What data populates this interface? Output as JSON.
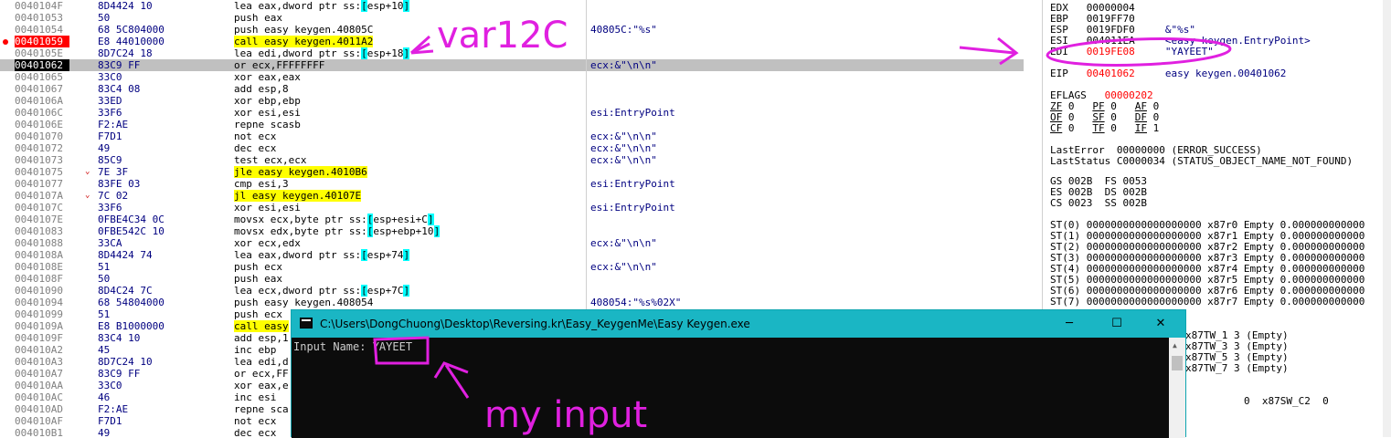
{
  "disassembly": [
    {
      "addr": "0040104F",
      "bytes": "8D4424 10",
      "instr": [
        {
          "t": "lea eax,dword ptr ss:"
        },
        {
          "t": "[",
          "h": "cyan"
        },
        {
          "t": "esp+10"
        },
        {
          "t": "]",
          "h": "cyan"
        }
      ],
      "comment": ""
    },
    {
      "addr": "00401053",
      "bytes": "50",
      "instr": [
        {
          "t": "push eax"
        }
      ],
      "comment": ""
    },
    {
      "addr": "00401054",
      "bytes": "68 5C804000",
      "instr": [
        {
          "t": "push easy keygen.40805C"
        }
      ],
      "comment": "40805C:\"%s\""
    },
    {
      "addr": "00401059",
      "bytes": "E8 44010000",
      "instr": [
        {
          "t": "call easy keygen.4011A2",
          "h": "yellow"
        }
      ],
      "comment": "",
      "bp": true
    },
    {
      "addr": "0040105E",
      "bytes": "8D7C24 18",
      "instr": [
        {
          "t": "lea edi,dword ptr ss:"
        },
        {
          "t": "[",
          "h": "cyan"
        },
        {
          "t": "esp+18"
        },
        {
          "t": "]",
          "h": "cyan"
        }
      ],
      "comment": ""
    },
    {
      "addr": "00401062",
      "bytes": "83C9 FF",
      "instr": [
        {
          "t": "or ecx,FFFFFFFF"
        }
      ],
      "comment": "ecx:&\"\\n\\n\"",
      "current": true
    },
    {
      "addr": "00401065",
      "bytes": "33C0",
      "instr": [
        {
          "t": "xor eax,eax"
        }
      ],
      "comment": ""
    },
    {
      "addr": "00401067",
      "bytes": "83C4 08",
      "instr": [
        {
          "t": "add esp,8"
        }
      ],
      "comment": ""
    },
    {
      "addr": "0040106A",
      "bytes": "33ED",
      "instr": [
        {
          "t": "xor ebp,ebp"
        }
      ],
      "comment": ""
    },
    {
      "addr": "0040106C",
      "bytes": "33F6",
      "instr": [
        {
          "t": "xor esi,esi"
        }
      ],
      "comment": "esi:EntryPoint"
    },
    {
      "addr": "0040106E",
      "bytes": "F2:AE",
      "instr": [
        {
          "t": "repne scasb"
        }
      ],
      "comment": ""
    },
    {
      "addr": "00401070",
      "bytes": "F7D1",
      "instr": [
        {
          "t": "not ecx"
        }
      ],
      "comment": "ecx:&\"\\n\\n\""
    },
    {
      "addr": "00401072",
      "bytes": "49",
      "instr": [
        {
          "t": "dec ecx"
        }
      ],
      "comment": "ecx:&\"\\n\\n\""
    },
    {
      "addr": "00401073",
      "bytes": "85C9",
      "instr": [
        {
          "t": "test ecx,ecx"
        }
      ],
      "comment": "ecx:&\"\\n\\n\""
    },
    {
      "addr": "00401075",
      "bytes": "7E 3F",
      "instr": [
        {
          "t": "jle easy keygen.4010B6",
          "h": "yellow"
        }
      ],
      "comment": "",
      "jump": true
    },
    {
      "addr": "00401077",
      "bytes": "83FE 03",
      "instr": [
        {
          "t": "cmp esi,3"
        }
      ],
      "comment": "esi:EntryPoint"
    },
    {
      "addr": "0040107A",
      "bytes": "7C 02",
      "instr": [
        {
          "t": "jl easy keygen.40107E",
          "h": "yellow"
        }
      ],
      "comment": "",
      "jump": true
    },
    {
      "addr": "0040107C",
      "bytes": "33F6",
      "instr": [
        {
          "t": "xor esi,esi"
        }
      ],
      "comment": "esi:EntryPoint"
    },
    {
      "addr": "0040107E",
      "bytes": "0FBE4C34 0C",
      "instr": [
        {
          "t": "movsx ecx,byte ptr ss:"
        },
        {
          "t": "[",
          "h": "cyan"
        },
        {
          "t": "esp+esi+C"
        },
        {
          "t": "]",
          "h": "cyan"
        }
      ],
      "comment": ""
    },
    {
      "addr": "00401083",
      "bytes": "0FBE542C 10",
      "instr": [
        {
          "t": "movsx edx,byte ptr ss:"
        },
        {
          "t": "[",
          "h": "cyan"
        },
        {
          "t": "esp+ebp+10"
        },
        {
          "t": "]",
          "h": "cyan"
        }
      ],
      "comment": ""
    },
    {
      "addr": "00401088",
      "bytes": "33CA",
      "instr": [
        {
          "t": "xor ecx,edx"
        }
      ],
      "comment": "ecx:&\"\\n\\n\""
    },
    {
      "addr": "0040108A",
      "bytes": "8D4424 74",
      "instr": [
        {
          "t": "lea eax,dword ptr ss:"
        },
        {
          "t": "[",
          "h": "cyan"
        },
        {
          "t": "esp+74"
        },
        {
          "t": "]",
          "h": "cyan"
        }
      ],
      "comment": ""
    },
    {
      "addr": "0040108E",
      "bytes": "51",
      "instr": [
        {
          "t": "push ecx"
        }
      ],
      "comment": "ecx:&\"\\n\\n\""
    },
    {
      "addr": "0040108F",
      "bytes": "50",
      "instr": [
        {
          "t": "push eax"
        }
      ],
      "comment": ""
    },
    {
      "addr": "00401090",
      "bytes": "8D4C24 7C",
      "instr": [
        {
          "t": "lea ecx,dword ptr ss:"
        },
        {
          "t": "[",
          "h": "cyan"
        },
        {
          "t": "esp+7C"
        },
        {
          "t": "]",
          "h": "cyan"
        }
      ],
      "comment": ""
    },
    {
      "addr": "00401094",
      "bytes": "68 54804000",
      "instr": [
        {
          "t": "push easy keygen.408054"
        }
      ],
      "comment": "408054:\"%s%02X\""
    },
    {
      "addr": "00401099",
      "bytes": "51",
      "instr": [
        {
          "t": "push ecx"
        }
      ],
      "comment": ""
    },
    {
      "addr": "0040109A",
      "bytes": "E8 B1000000",
      "instr": [
        {
          "t": "call easy",
          "h": "yellow"
        }
      ],
      "comment": ""
    },
    {
      "addr": "0040109F",
      "bytes": "83C4 10",
      "instr": [
        {
          "t": "add esp,1"
        }
      ],
      "comment": ""
    },
    {
      "addr": "004010A2",
      "bytes": "45",
      "instr": [
        {
          "t": "inc ebp"
        }
      ],
      "comment": ""
    },
    {
      "addr": "004010A3",
      "bytes": "8D7C24 10",
      "instr": [
        {
          "t": "lea edi,d"
        }
      ],
      "comment": ""
    },
    {
      "addr": "004010A7",
      "bytes": "83C9 FF",
      "instr": [
        {
          "t": "or ecx,FF"
        }
      ],
      "comment": ""
    },
    {
      "addr": "004010AA",
      "bytes": "33C0",
      "instr": [
        {
          "t": "xor eax,e"
        }
      ],
      "comment": ""
    },
    {
      "addr": "004010AC",
      "bytes": "46",
      "instr": [
        {
          "t": "inc esi"
        }
      ],
      "comment": ""
    },
    {
      "addr": "004010AD",
      "bytes": "F2:AE",
      "instr": [
        {
          "t": "repne sca"
        }
      ],
      "comment": ""
    },
    {
      "addr": "004010AF",
      "bytes": "F7D1",
      "instr": [
        {
          "t": "not ecx"
        }
      ],
      "comment": ""
    },
    {
      "addr": "004010B1",
      "bytes": "49",
      "instr": [
        {
          "t": "dec ecx"
        }
      ],
      "comment": ""
    }
  ],
  "registers": {
    "edx": {
      "name": "EDX",
      "value": "00000004",
      "info": ""
    },
    "ebp": {
      "name": "EBP",
      "value": "0019FF70",
      "info": ""
    },
    "esp": {
      "name": "ESP",
      "value": "0019FDF0",
      "info": "&\"%s\""
    },
    "esi": {
      "name": "ESI",
      "value": "004011EA",
      "info": "<easy keygen.EntryPoint>"
    },
    "edi": {
      "name": "EDI",
      "value": "0019FE08",
      "info": "\"YAYEET\""
    },
    "eip": {
      "name": "EIP",
      "value": "00401062",
      "info": "easy keygen.00401062"
    },
    "eflags": {
      "name": "EFLAGS",
      "value": "00000202"
    },
    "flags_rows": [
      [
        {
          "n": "ZF",
          "v": "0"
        },
        {
          "n": "PF",
          "v": "0"
        },
        {
          "n": "AF",
          "v": "0"
        }
      ],
      [
        {
          "n": "OF",
          "v": "0"
        },
        {
          "n": "SF",
          "v": "0"
        },
        {
          "n": "DF",
          "v": "0"
        }
      ],
      [
        {
          "n": "CF",
          "v": "0"
        },
        {
          "n": "TF",
          "v": "0"
        },
        {
          "n": "IF",
          "v": "1"
        }
      ]
    ],
    "last_error": "LastError  00000000 (ERROR_SUCCESS)",
    "last_status": "LastStatus C0000034 (STATUS_OBJECT_NAME_NOT_FOUND)",
    "segments": [
      "GS 002B  FS 0053",
      "ES 002B  DS 002B",
      "CS 0023  SS 002B"
    ],
    "fpu": [
      "ST(0) 0000000000000000000 x87r0 Empty 0.000000000000",
      "ST(1) 0000000000000000000 x87r1 Empty 0.000000000000",
      "ST(2) 0000000000000000000 x87r2 Empty 0.000000000000",
      "ST(3) 0000000000000000000 x87r3 Empty 0.000000000000",
      "ST(4) 0000000000000000000 x87r4 Empty 0.000000000000",
      "ST(5) 0000000000000000000 x87r5 Empty 0.000000000000",
      "ST(6) 0000000000000000000 x87r6 Empty 0.000000000000",
      "ST(7) 0000000000000000000 x87r7 Empty 0.000000000000"
    ],
    "tag_words": [
      "x87TW_1 3 (Empty)",
      "x87TW_3 3 (Empty)",
      "x87TW_5 3 (Empty)",
      "x87TW_7 3 (Empty)"
    ],
    "status_word_fragment": "0  x87SW_C2  0"
  },
  "console": {
    "title": "C:\\Users\\DongChuong\\Desktop\\Reversing.kr\\Easy_KeygenMe\\Easy Keygen.exe",
    "minimize": "─",
    "maximize": "☐",
    "close": "✕",
    "prompt": "Input Name: ",
    "input_value": "YAYEET"
  },
  "annotations": {
    "var_label": "var12C",
    "input_label": "my input",
    "color": "#e020e0"
  }
}
